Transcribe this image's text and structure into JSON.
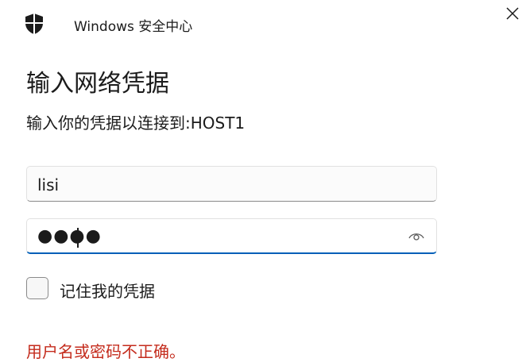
{
  "header": {
    "app_title": "Windows 安全中心",
    "app_icon": "shield-icon",
    "close_icon": "close-icon"
  },
  "dialog": {
    "title": "输入网络凭据",
    "subtitle": "输入你的凭据以连接到:HOST1"
  },
  "form": {
    "username_value": "lisi",
    "password_mask": "●●●●",
    "password_reveal_icon": "eye-icon",
    "remember_label": "记住我的凭据",
    "remember_checked": false
  },
  "error": {
    "message": "用户名或密码不正确。"
  },
  "colors": {
    "accent": "#005fb8",
    "error": "#c42b1c",
    "text": "#1b1b1b"
  }
}
